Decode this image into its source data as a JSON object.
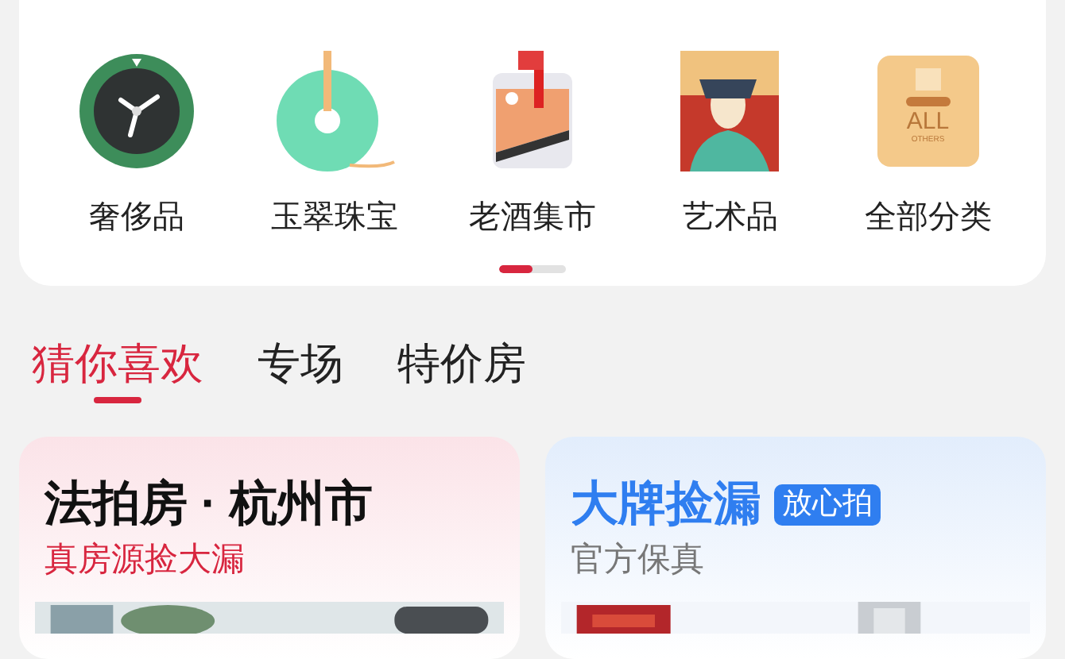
{
  "categories": [
    {
      "kind": "watch",
      "label": "奢侈品"
    },
    {
      "kind": "jade",
      "label": "玉翠珠宝"
    },
    {
      "kind": "liquor",
      "label": "老酒集市"
    },
    {
      "kind": "art",
      "label": "艺术品"
    },
    {
      "kind": "box",
      "label": "全部分类",
      "icon_text": "ALL",
      "icon_subtext": "OTHERS"
    }
  ],
  "pager": {
    "level": 0.5
  },
  "tabs": [
    {
      "label": "猜你喜欢",
      "selected": true
    },
    {
      "label": "专场",
      "selected": false
    },
    {
      "label": "特价房",
      "selected": false
    }
  ],
  "cards": [
    {
      "kind": "court",
      "title": "法拍房 · 杭州市",
      "subtitle": "真房源捡大漏"
    },
    {
      "kind": "brand",
      "title": "大牌捡漏",
      "badge": "放心拍",
      "subtitle": "官方保真"
    }
  ]
}
